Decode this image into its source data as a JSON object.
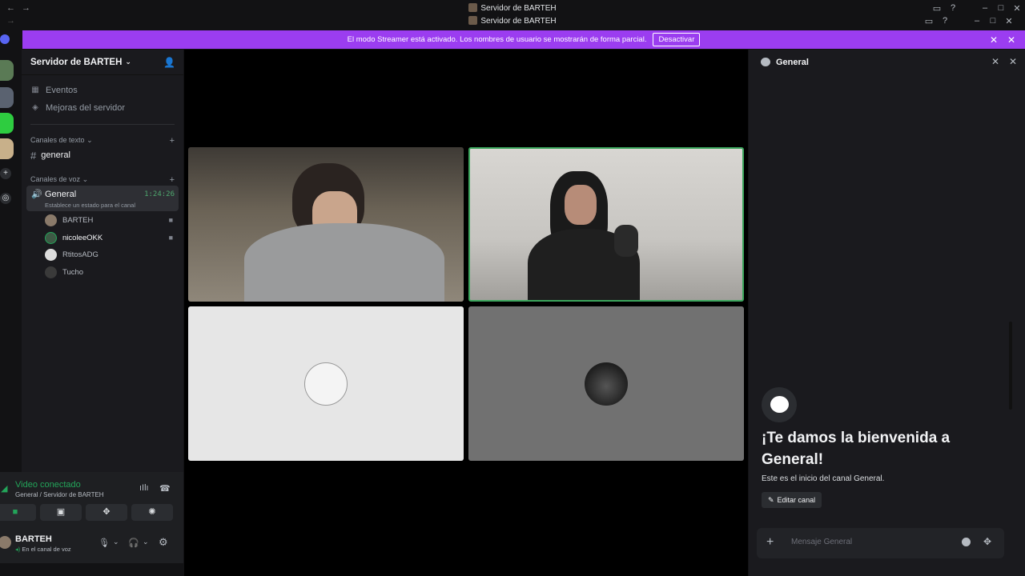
{
  "window": {
    "title_primary": "Servidor de BARTEH",
    "title_secondary": "Servidor de BARTEH"
  },
  "banner": {
    "text": "El modo Streamer está activado. Los nombres de usuario se mostrarán de forma parcial.",
    "button_label": "Desactivar"
  },
  "server": {
    "name": "Servidor de BARTEH",
    "menu_items": [
      {
        "label": "Eventos",
        "icon": "calendar-icon"
      },
      {
        "label": "Mejoras del servidor",
        "icon": "boost-icon"
      }
    ],
    "text_category": "Canales de texto",
    "text_channels": [
      {
        "name": "general"
      }
    ],
    "voice_category": "Canales de voz",
    "voice_channel": {
      "name": "General",
      "elapsed": "1:24:26",
      "status_placeholder": "Establece un estado para el canal"
    },
    "voice_users": [
      {
        "name": "BARTEH",
        "camera": true
      },
      {
        "name": "nicoleeOKK",
        "camera": true
      },
      {
        "name": "RtitosADG",
        "camera": false
      },
      {
        "name": "Tucho",
        "camera": false
      }
    ]
  },
  "voice_panel": {
    "status": "Video conectado",
    "location": "General / Servidor de BARTEH"
  },
  "user": {
    "name": "BARTEH",
    "status": "En el canal de voz"
  },
  "chat": {
    "channel_name": "General",
    "welcome_title": "¡Te damos la bienvenida a General!",
    "welcome_sub": "Este es el inicio del canal General.",
    "edit_button": "Editar canal",
    "input_placeholder": "Mensaje General"
  },
  "colors": {
    "banner": "#9b3df0",
    "connected_green": "#23a55a",
    "speaking_outline": "#3ba55c"
  }
}
